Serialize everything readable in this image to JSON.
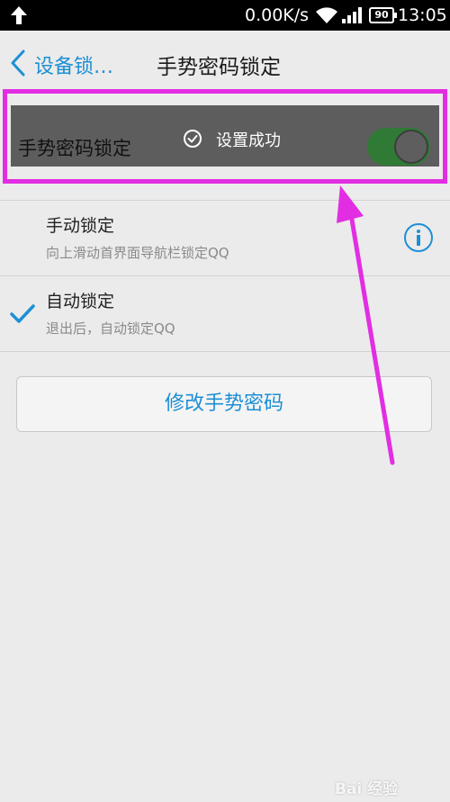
{
  "status_bar": {
    "speed": "0.00K/s",
    "battery": "90",
    "time": "13:05",
    "icons": [
      "upload-arrow-icon",
      "wifi-icon",
      "signal-icon",
      "battery-icon"
    ]
  },
  "header": {
    "back_label": "设备锁…",
    "title": "手势密码锁定"
  },
  "gesture_lock": {
    "label": "手势密码锁定",
    "toast": "设置成功",
    "enabled": true
  },
  "options": [
    {
      "title": "手动锁定",
      "subtitle": "向上滑动首界面导航栏锁定QQ",
      "selected": false,
      "has_info": true
    },
    {
      "title": "自动锁定",
      "subtitle": "退出后，自动锁定QQ",
      "selected": true,
      "has_info": false
    }
  ],
  "modify_button": "修改手势密码",
  "watermark": "Bai 经验",
  "colors": {
    "accent": "#1d8fd6",
    "toggle_on": "#2f7a35",
    "annotation": "#e22ee2",
    "background": "#ebebeb"
  }
}
